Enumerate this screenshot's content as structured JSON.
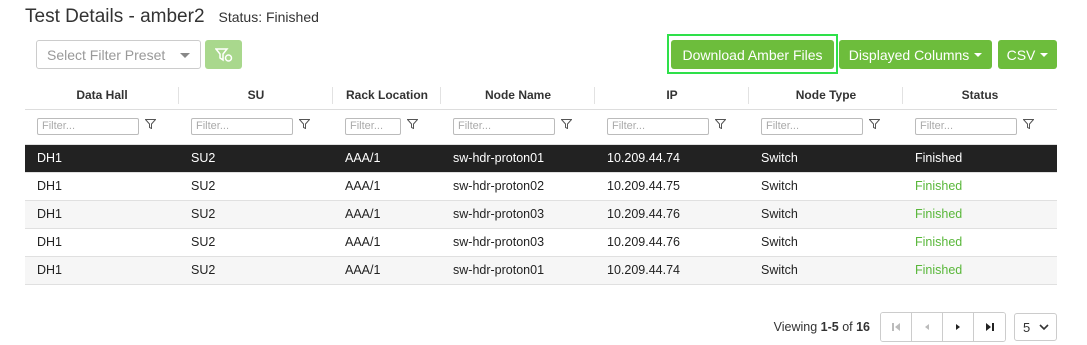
{
  "header": {
    "title": "Test Details - amber2",
    "status": "Status: Finished"
  },
  "toolbar": {
    "preset_placeholder": "Select Filter Preset",
    "download_label": "Download Amber Files",
    "columns_label": "Displayed Columns",
    "csv_label": "CSV"
  },
  "colors": {
    "accent": "#6dbd3c",
    "highlight": "#2ee04a",
    "selected_row": "#222222",
    "status_finished": "#59b73a"
  },
  "table": {
    "columns": [
      "Data Hall",
      "SU",
      "Rack Location",
      "Node Name",
      "IP",
      "Node Type",
      "Status"
    ],
    "filter_placeholder": "Filter...",
    "rows": [
      [
        "DH1",
        "SU2",
        "AAA/1",
        "sw-hdr-proton01",
        "10.209.44.74",
        "Switch",
        "Finished"
      ],
      [
        "DH1",
        "SU2",
        "AAA/1",
        "sw-hdr-proton02",
        "10.209.44.75",
        "Switch",
        "Finished"
      ],
      [
        "DH1",
        "SU2",
        "AAA/1",
        "sw-hdr-proton03",
        "10.209.44.76",
        "Switch",
        "Finished"
      ],
      [
        "DH1",
        "SU2",
        "AAA/1",
        "sw-hdr-proton03",
        "10.209.44.76",
        "Switch",
        "Finished"
      ],
      [
        "DH1",
        "SU2",
        "AAA/1",
        "sw-hdr-proton01",
        "10.209.44.74",
        "Switch",
        "Finished"
      ]
    ]
  },
  "pager": {
    "viewing_prefix": "Viewing ",
    "range": "1-5",
    "of_text": " of ",
    "total": "16",
    "page_size": "5"
  }
}
